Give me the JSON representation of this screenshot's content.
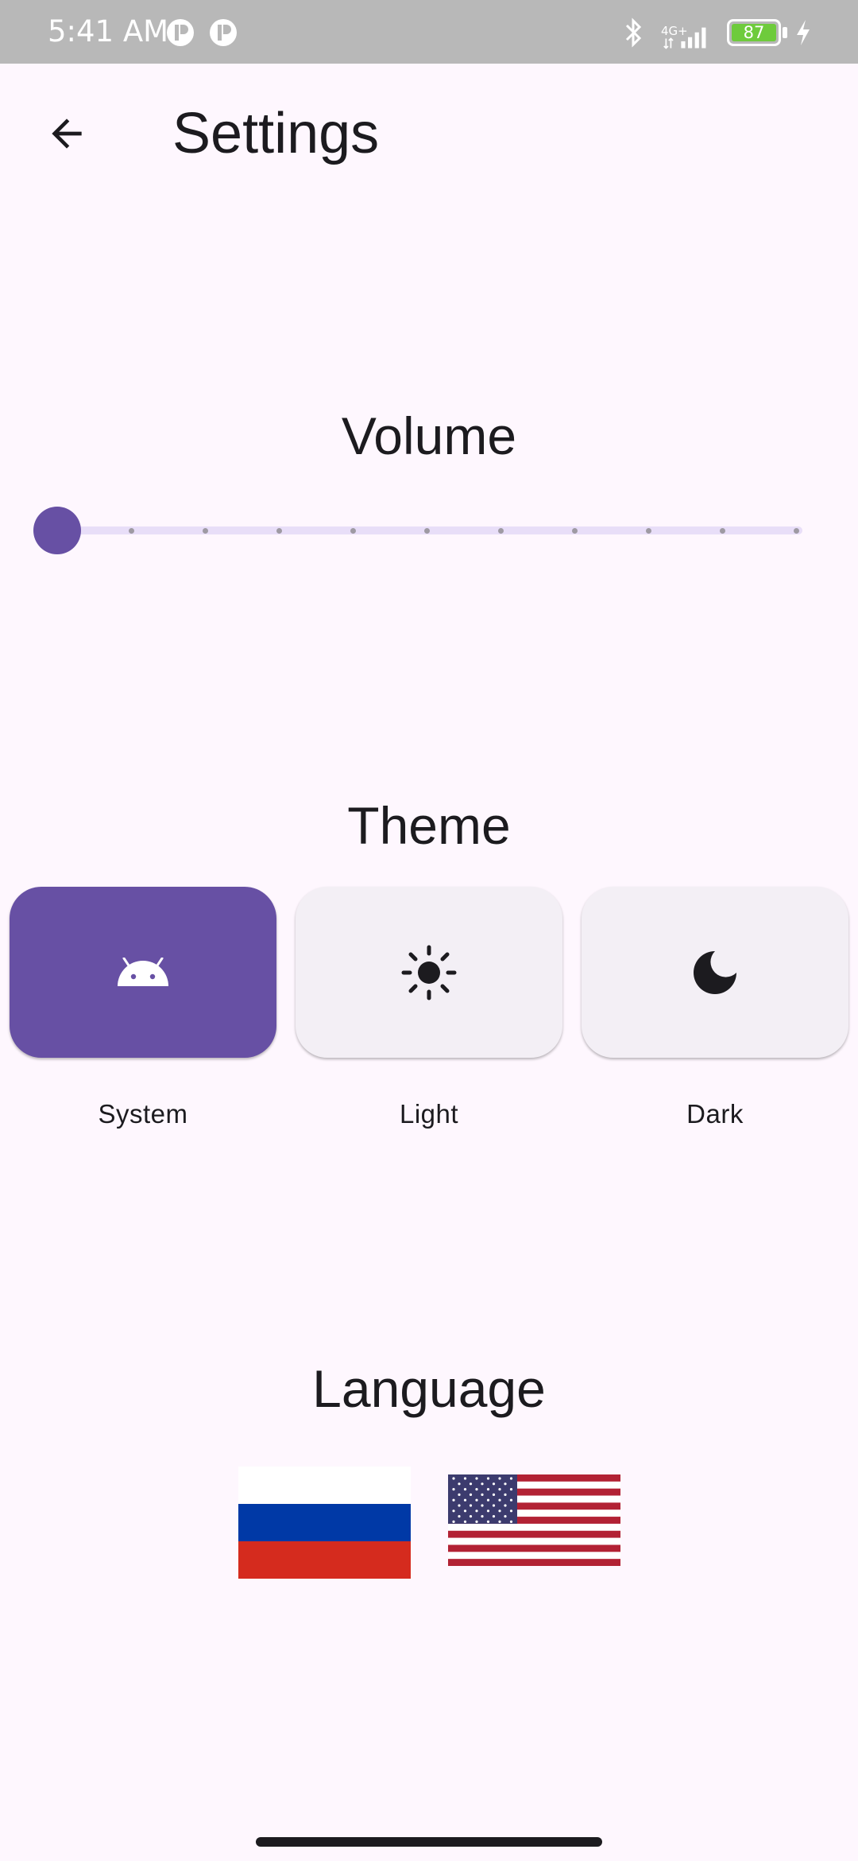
{
  "status_bar": {
    "time": "5:41 AM",
    "battery_level": "87",
    "network": "4G+",
    "icons": [
      "notification-icon",
      "notification-icon",
      "bluetooth-icon",
      "signal-icon",
      "battery-icon",
      "charging-icon"
    ]
  },
  "app_bar": {
    "title": "Settings",
    "back_icon": "arrow-back-icon"
  },
  "volume": {
    "title": "Volume",
    "value": 0,
    "min": 0,
    "max": 10,
    "divisions": 10
  },
  "theme": {
    "title": "Theme",
    "selected": "System",
    "options": [
      {
        "label": "System",
        "icon": "android-icon"
      },
      {
        "label": "Light",
        "icon": "sun-icon"
      },
      {
        "label": "Dark",
        "icon": "moon-icon"
      }
    ]
  },
  "language": {
    "title": "Language",
    "options": [
      {
        "icon": "flag-russia-icon"
      },
      {
        "icon": "flag-usa-icon"
      }
    ]
  },
  "colors": {
    "primary": "#6750A4",
    "background": "#FEF7FE",
    "card_unselected": "#F3EFF5",
    "slider_inactive": "#E8DEF8",
    "status_bar": "#B8B8B8",
    "battery": "#6ECB3C"
  }
}
